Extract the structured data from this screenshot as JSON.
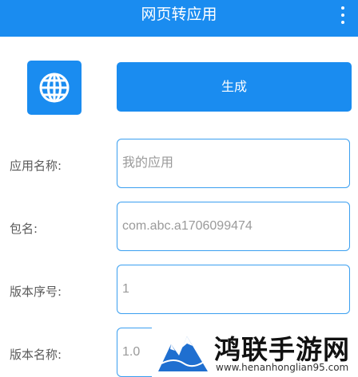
{
  "appbar": {
    "title": "网页转应用",
    "menu_icon": "more-vert-icon"
  },
  "colors": {
    "primary": "#1a8cf0",
    "field_border": "#3a9ff0"
  },
  "icon_button": {
    "icon": "globe-icon"
  },
  "generate_button": {
    "label": "生成"
  },
  "form": {
    "app_name": {
      "label": "应用名称:",
      "placeholder": "我的应用"
    },
    "package_name": {
      "label": "包名:",
      "placeholder": "com.abc.a1706099474"
    },
    "version_code": {
      "label": "版本序号:",
      "placeholder": "1"
    },
    "version_name": {
      "label": "版本名称:",
      "placeholder": "1.0"
    }
  },
  "watermark": {
    "title": "鸿联手游网",
    "url": "www.henanhonglian95.com"
  }
}
